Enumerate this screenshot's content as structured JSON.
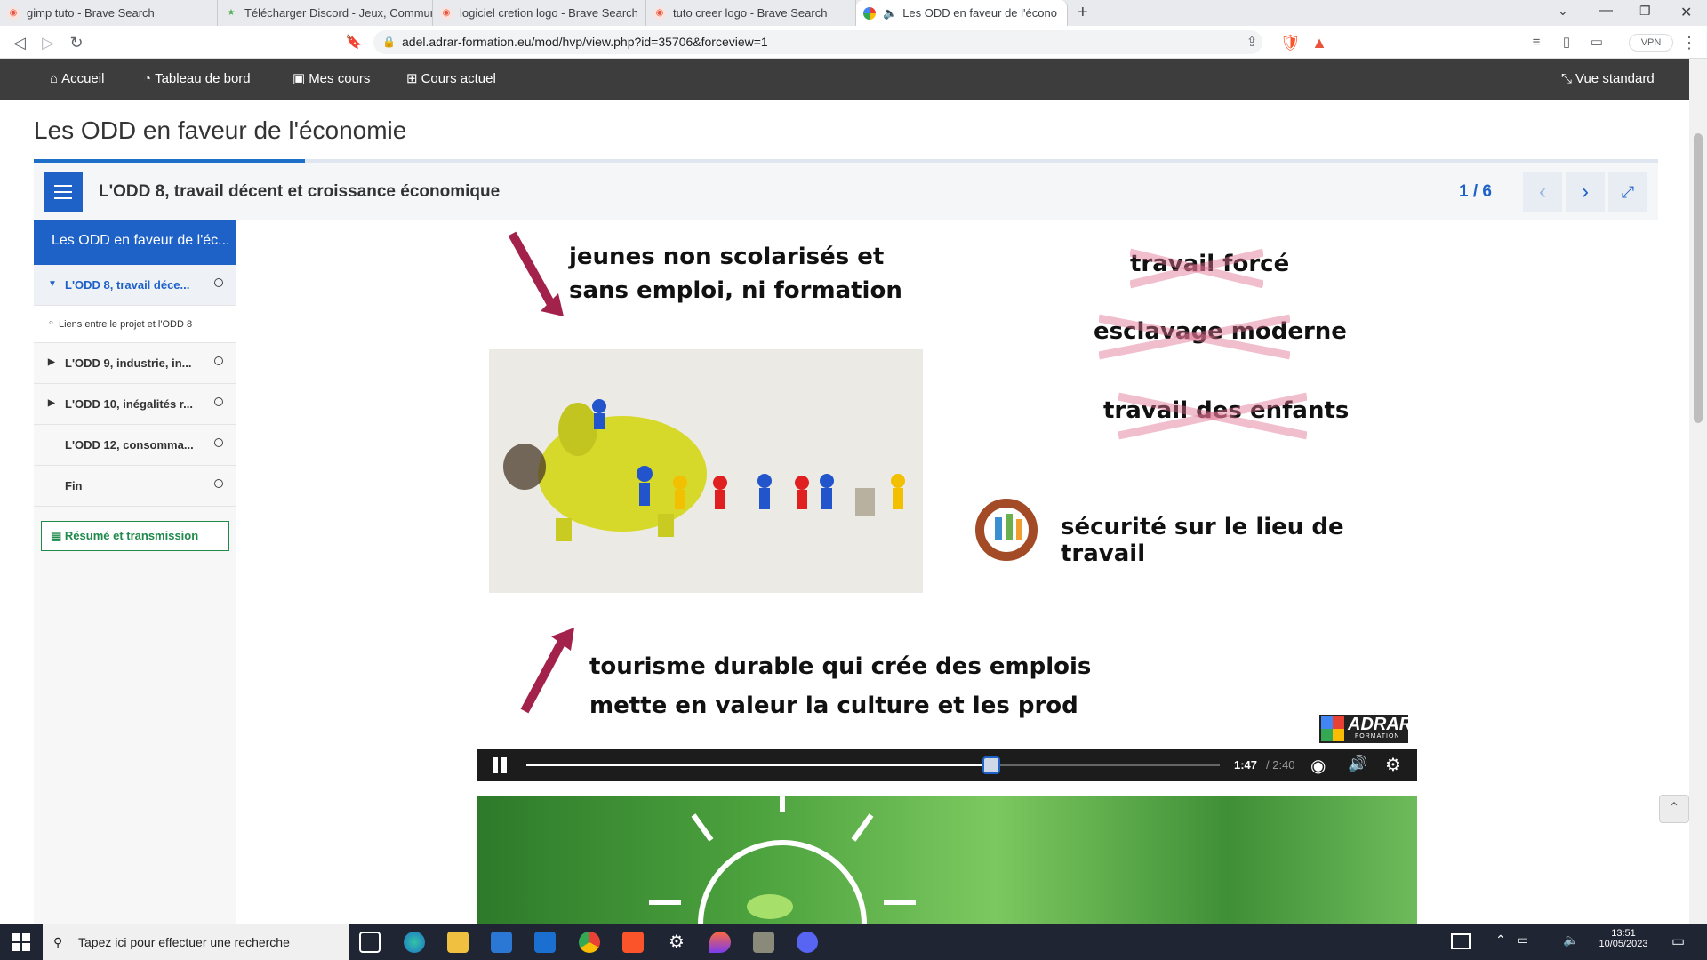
{
  "browser": {
    "tabs": [
      {
        "title": "gimp tuto - Brave Search"
      },
      {
        "title": "Télécharger Discord - Jeux, Communic"
      },
      {
        "title": "logiciel cretion logo - Brave Search"
      },
      {
        "title": "tuto creer logo - Brave Search"
      },
      {
        "title": "Les ODD en faveur de l'écono"
      }
    ],
    "url": "adel.adrar-formation.eu/mod/hvp/view.php?id=35706&forceview=1",
    "vpn_label": "VPN"
  },
  "moodle_nav": {
    "home": "Accueil",
    "dashboard": "Tableau de bord",
    "my_courses": "Mes cours",
    "current_course": "Cours actuel",
    "standard_view": "Vue standard"
  },
  "page": {
    "title": "Les ODD en faveur de l'économie",
    "progress_fraction": 0.167
  },
  "h5p": {
    "chapter_title": "L'ODD 8, travail décent et croissance économique",
    "page_counter": "1 / 6"
  },
  "sidebar": {
    "header": "Les ODD en faveur de l'éc...",
    "items": [
      {
        "label": "L'ODD 8, travail déce..."
      },
      {
        "label": "Liens entre le projet et l'ODD 8"
      },
      {
        "label": "L'ODD 9, industrie, in..."
      },
      {
        "label": "L'ODD 10, inégalités r..."
      },
      {
        "label": "L'ODD 12, consomma..."
      },
      {
        "label": "Fin"
      }
    ],
    "summary_button": "Résumé et transmission"
  },
  "video": {
    "text_top_1": "jeunes non scolarisés et",
    "text_top_2": "sans emploi, ni formation",
    "crossed_1": "travail forcé",
    "crossed_2": "esclavage moderne",
    "crossed_3": "travail des enfants",
    "safety": "sécurité sur le lieu de travail",
    "bottom_1": "tourisme durable qui crée des emplois",
    "bottom_2": "mette en valeur la culture et les prod",
    "logo": "ADRAR",
    "logo_sub": "FORMATION",
    "time_current": "1:47",
    "time_total": "/ 2:40",
    "progress_fraction": 0.67
  },
  "taskbar": {
    "search_placeholder": "Tapez ici pour effectuer une recherche",
    "time": "13:51",
    "date": "10/05/2023"
  }
}
